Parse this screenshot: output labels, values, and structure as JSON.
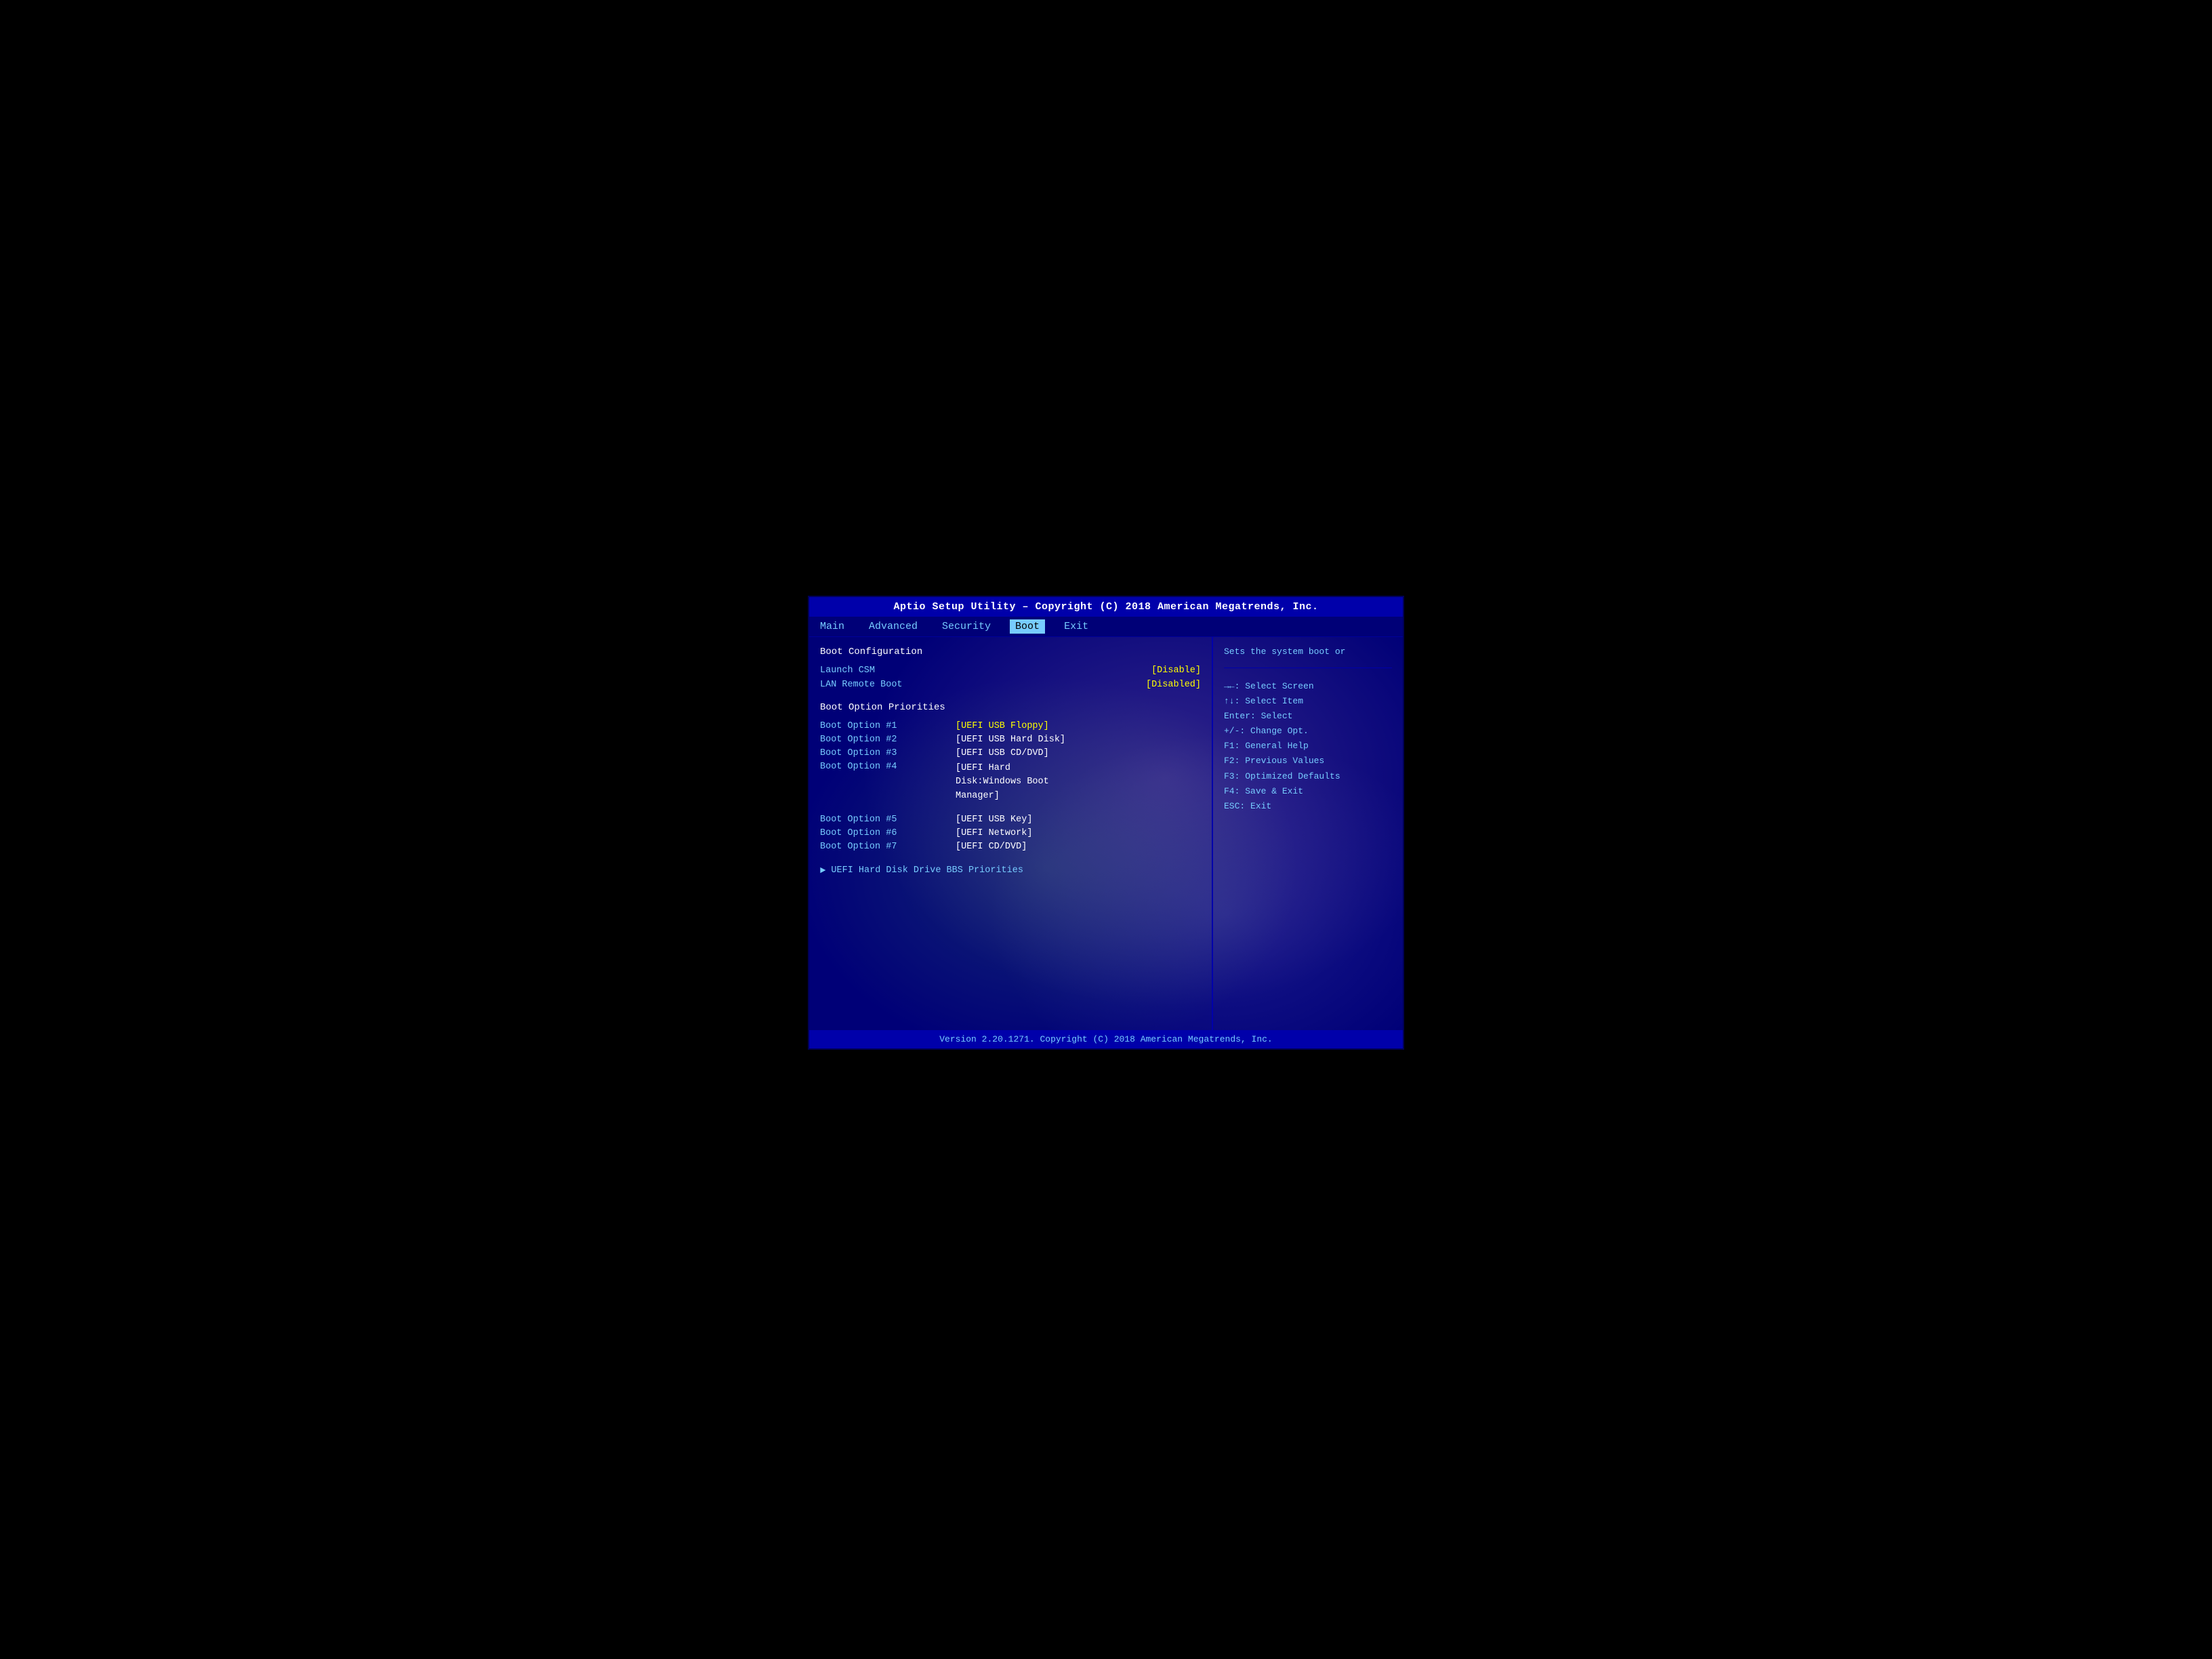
{
  "title_bar": {
    "text": "Aptio Setup Utility – Copyright (C) 2018 American Megatrends, Inc."
  },
  "menu": {
    "items": [
      {
        "label": "Main",
        "active": false
      },
      {
        "label": "Advanced",
        "active": false
      },
      {
        "label": "Security",
        "active": false
      },
      {
        "label": "Boot",
        "active": true
      },
      {
        "label": "Exit",
        "active": false
      }
    ]
  },
  "left_panel": {
    "section_title": "Boot Configuration",
    "launch_csm_label": "Launch CSM",
    "launch_csm_value": "[Disable]",
    "lan_remote_boot_label": "LAN Remote Boot",
    "lan_remote_boot_value": "[Disabled]",
    "boot_option_priorities_label": "Boot Option Priorities",
    "boot_options": [
      {
        "label": "Boot Option #1",
        "value": "[UEFI USB Floppy]"
      },
      {
        "label": "Boot Option #2",
        "value": "[UEFI USB Hard Disk]"
      },
      {
        "label": "Boot Option #3",
        "value": "[UEFI USB CD/DVD]"
      },
      {
        "label": "Boot Option #4",
        "value": "[UEFI Hard Disk:Windows Boot Manager]"
      },
      {
        "label": "Boot Option #5",
        "value": "[UEFI USB Key]"
      },
      {
        "label": "Boot Option #6",
        "value": "[UEFI Network]"
      },
      {
        "label": "Boot Option #7",
        "value": "[UEFI CD/DVD]"
      }
    ],
    "bbs_label": "UEFI Hard Disk Drive BBS Priorities"
  },
  "right_panel": {
    "description": "Sets the system boot or",
    "hints": [
      {
        "key": "→←:",
        "action": "Select Screen"
      },
      {
        "key": "↑↓:",
        "action": "Select Item"
      },
      {
        "key": "Enter:",
        "action": "Select"
      },
      {
        "key": "+/-:",
        "action": "Change Opt."
      },
      {
        "key": "F1:",
        "action": "General Help"
      },
      {
        "key": "F2:",
        "action": "Previous Values"
      },
      {
        "key": "F3:",
        "action": "Optimized Defaults"
      },
      {
        "key": "F4:",
        "action": "Save & Exit"
      },
      {
        "key": "ESC:",
        "action": "Exit"
      }
    ]
  },
  "footer": {
    "text": "Version 2.20.1271. Copyright (C) 2018 American Megatrends, Inc."
  }
}
